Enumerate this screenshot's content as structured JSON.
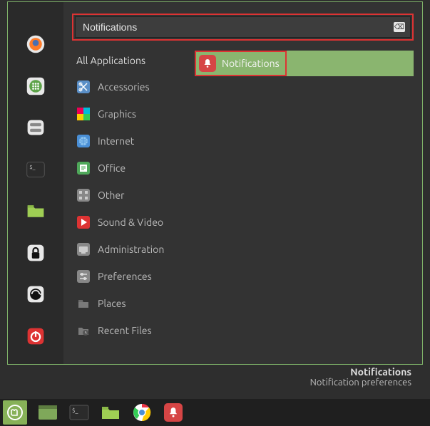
{
  "search": {
    "value": "Notifications",
    "clear_glyph": "⌫"
  },
  "categories": {
    "all": "All Applications",
    "items": [
      {
        "id": "accessories",
        "label": "Accessories"
      },
      {
        "id": "graphics",
        "label": "Graphics"
      },
      {
        "id": "internet",
        "label": "Internet"
      },
      {
        "id": "office",
        "label": "Office"
      },
      {
        "id": "other",
        "label": "Other"
      },
      {
        "id": "sound",
        "label": "Sound & Video"
      },
      {
        "id": "admin",
        "label": "Administration"
      },
      {
        "id": "prefs",
        "label": "Preferences"
      },
      {
        "id": "places",
        "label": "Places"
      },
      {
        "id": "recent",
        "label": "Recent Files"
      }
    ]
  },
  "result": {
    "label": "Notifications"
  },
  "tooltip": {
    "title": "Notifications",
    "desc": "Notification preferences"
  },
  "sidebar_favorites": [
    "firefox",
    "apps-grid",
    "disks",
    "terminal",
    "files",
    "lock",
    "logout",
    "power"
  ],
  "taskbar_items": [
    "mint-menu",
    "file-manager",
    "terminal",
    "files",
    "chrome",
    "notifications"
  ]
}
